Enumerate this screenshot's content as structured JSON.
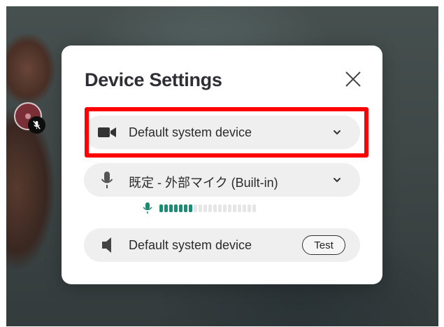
{
  "dialog": {
    "title": "Device Settings"
  },
  "camera": {
    "icon": "video-camera-icon",
    "selected": "Default system device"
  },
  "microphone": {
    "icon": "microphone-icon",
    "selected": "既定 - 外部マイク (Built-in)",
    "level_active_bars": 7,
    "level_total_bars": 20,
    "level_color": "#1d8a73"
  },
  "speaker": {
    "icon": "speaker-icon",
    "selected": "Default system device",
    "test_label": "Test"
  },
  "colors": {
    "highlight": "#ff0000",
    "row_background": "#efefef"
  }
}
